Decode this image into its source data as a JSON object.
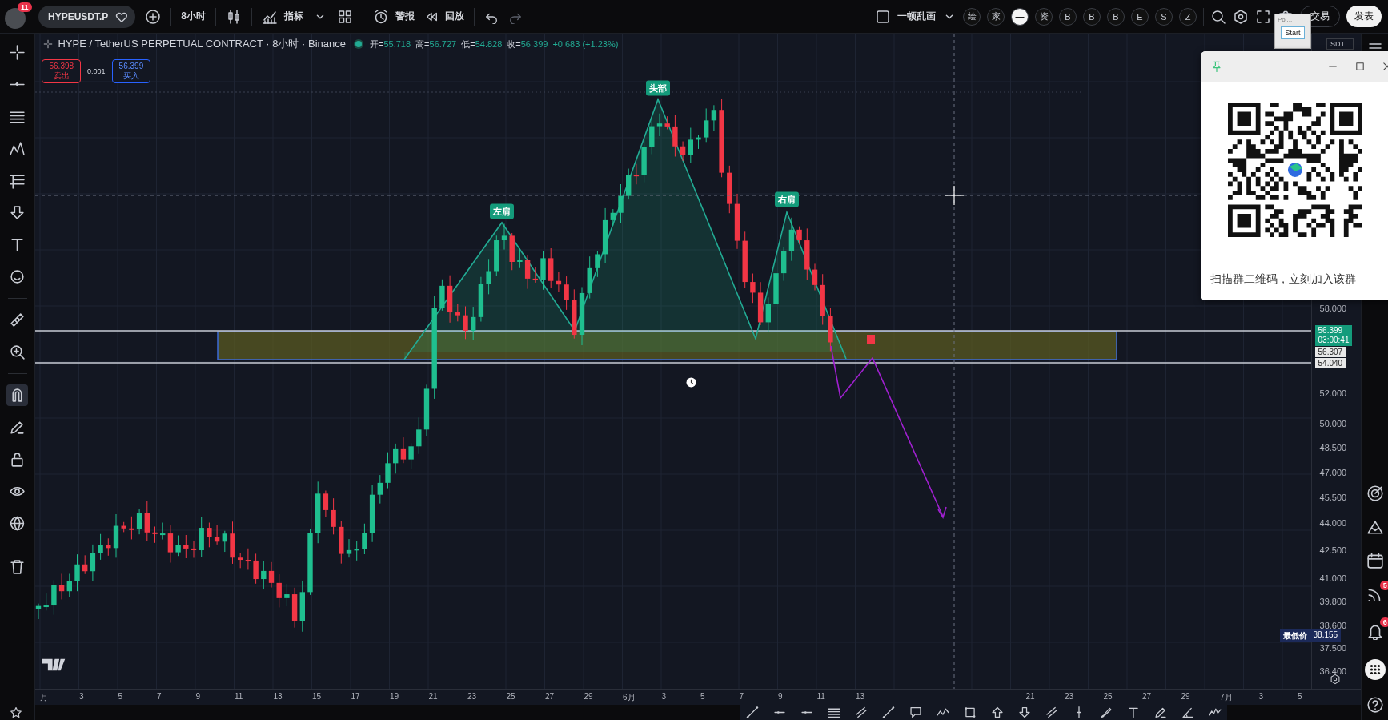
{
  "top_bar": {
    "notification_count": "11",
    "symbol": "HYPEUSDT.P",
    "interval": "8小时",
    "indicators_label": "指标",
    "alerts_label": "警报",
    "replay_label": "回放",
    "layout_name": "一顿乱画",
    "quick_buttons": [
      {
        "label": "绘",
        "selected": false
      },
      {
        "label": "家",
        "selected": false
      },
      {
        "label": "—",
        "selected": true
      },
      {
        "label": "资",
        "selected": false
      },
      {
        "label": "B",
        "selected": false
      },
      {
        "label": "B",
        "selected": false
      },
      {
        "label": "B",
        "selected": false
      },
      {
        "label": "E",
        "selected": false
      },
      {
        "label": "S",
        "selected": false
      },
      {
        "label": "Z",
        "selected": false
      }
    ],
    "trade_button": "交易",
    "publish_button": "发表"
  },
  "overlay_window": {
    "title": "Poi...",
    "button": "Start",
    "behind_select": "SDT"
  },
  "legend": {
    "title": "HYPE / TetherUS PERPETUAL CONTRACT · 8小时 · Binance",
    "open_label": "开=",
    "open": "55.718",
    "high_label": "高=",
    "high": "56.727",
    "low_label": "低=",
    "low": "54.828",
    "close_label": "收=",
    "close": "56.399",
    "change": "+0.683 (+1.23%)"
  },
  "order_buttons": {
    "sell_price": "56.398",
    "sell_label": "卖出",
    "quantity": "0.001",
    "buy_price": "56.399",
    "buy_label": "买入"
  },
  "chart": {
    "pattern_labels": [
      "左肩",
      "头部",
      "右肩"
    ]
  },
  "price_axis": {
    "ticks": [
      "58.000",
      "52.000",
      "50.000",
      "48.500",
      "47.000",
      "45.500",
      "44.000",
      "42.500",
      "41.000",
      "39.800",
      "38.600",
      "37.500",
      "36.400"
    ],
    "last_price": "56.399",
    "countdown": "03:00:41",
    "zone_labels": [
      "56.307",
      "54.040"
    ],
    "low_label": "最低价",
    "low_price": "38.155"
  },
  "time_axis": {
    "ticks": [
      "月",
      "3",
      "5",
      "7",
      "9",
      "11",
      "13",
      "15",
      "17",
      "19",
      "21",
      "23",
      "25",
      "27",
      "29",
      "6月",
      "3",
      "5",
      "7",
      "9",
      "11",
      "13"
    ],
    "ticks_after_cursor": [
      "21",
      "23",
      "25",
      "27",
      "29",
      "7月",
      "3",
      "5"
    ]
  },
  "side_badges": {
    "feed": "5",
    "alerts": "6"
  },
  "qr_popup": {
    "caption": "扫描群二维码，立刻加入该群"
  }
}
